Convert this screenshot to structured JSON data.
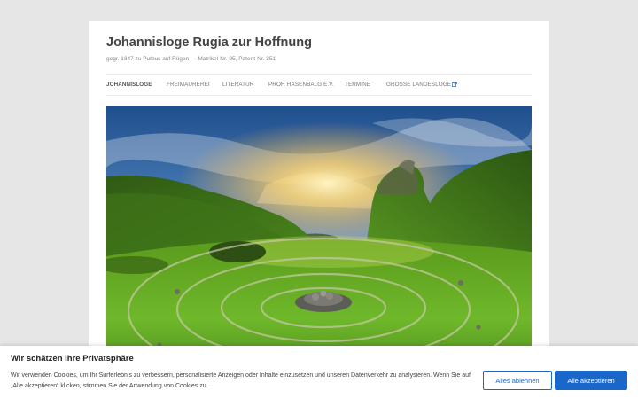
{
  "site": {
    "title": "Johannisloge Rugia zur Hoffnung",
    "description": "gegr. 1847 zu Putbus auf Rügen — Matrikel-Nr. 95, Patent-Nr. 351"
  },
  "nav": {
    "items": [
      {
        "label": "JOHANNISLOGE"
      },
      {
        "label": "FREIMAUREREI"
      },
      {
        "label": "LITERATUR"
      },
      {
        "label": "PROF. HASENBALG E.V."
      },
      {
        "label": "TERMINE"
      },
      {
        "label": "GROSSE LANDESLOGE"
      }
    ],
    "external_icon": "external-link-icon"
  },
  "hero": {
    "image": "landscape-sunset-stone-spiral"
  },
  "cookie": {
    "title": "Wir schätzen Ihre Privatsphäre",
    "text": "Wir verwenden Cookies, um Ihr Surferlebnis zu verbessern, personalisierte Anzeigen oder Inhalte einzusetzen und unseren Datenverkehr zu analysieren. Wenn Sie auf „Alle akzeptieren“ klicken, stimmen Sie der Anwendung von Cookies zu.",
    "decline_label": "Alles ablehnen",
    "accept_label": "Alle akzeptieren"
  },
  "colors": {
    "background": "#e6e6e6",
    "accent": "#1a66c9"
  }
}
